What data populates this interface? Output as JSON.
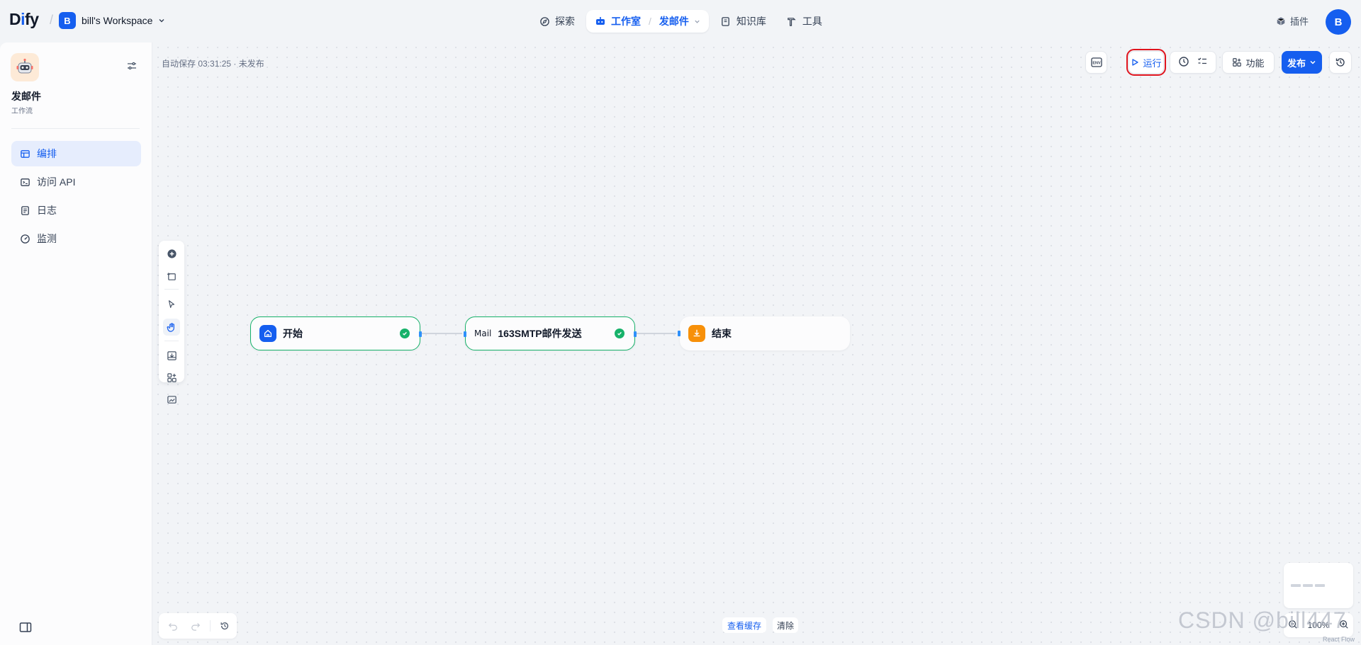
{
  "header": {
    "logo": "Dify",
    "workspace": {
      "avatar": "B",
      "name": "bill's Workspace"
    },
    "nav": {
      "explore": "探索",
      "studio": "工作室",
      "current_app": "发邮件",
      "knowledge": "知识库",
      "tools": "工具"
    },
    "plugins": "插件",
    "user_avatar": "B"
  },
  "sidebar": {
    "app_name": "发邮件",
    "app_type": "工作流",
    "items": [
      {
        "label": "编排",
        "icon": "layout-icon",
        "active": true
      },
      {
        "label": "访问 API",
        "icon": "terminal-icon",
        "active": false
      },
      {
        "label": "日志",
        "icon": "file-list-icon",
        "active": false
      },
      {
        "label": "监测",
        "icon": "gauge-icon",
        "active": false
      }
    ]
  },
  "canvas": {
    "autosave": "自动保存 03:31:25 · 未发布",
    "toolbar": {
      "env": "ENV",
      "run": "运行",
      "features": "功能",
      "publish": "发布"
    },
    "nodes": [
      {
        "title": "开始",
        "icon": "home-icon",
        "color": "#155eef",
        "status": "success"
      },
      {
        "title": "163SMTP邮件发送",
        "icon_text": "Mail",
        "status": "success"
      },
      {
        "title": "结束",
        "icon": "flag-icon",
        "color": "#f79009",
        "status": "none"
      }
    ],
    "cache": {
      "view": "查看缓存",
      "clear": "清除"
    },
    "zoom": "100%",
    "attribution": "React Flow"
  },
  "watermark": "CSDN @bill447"
}
